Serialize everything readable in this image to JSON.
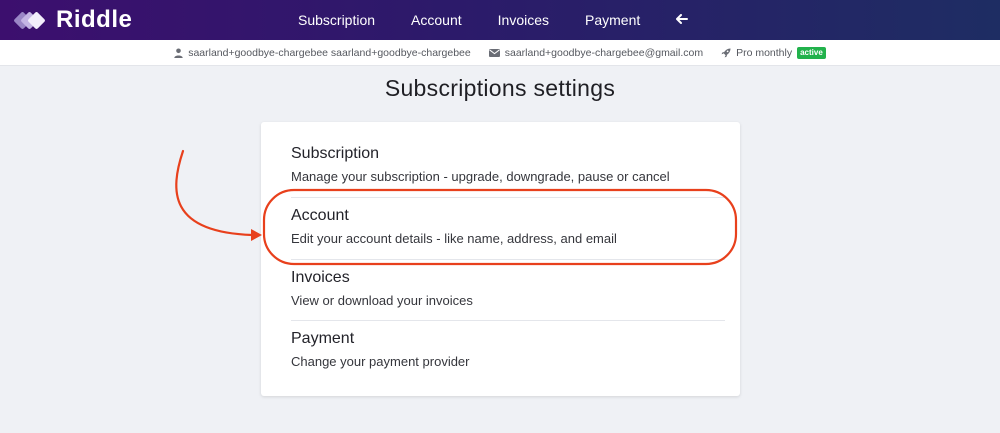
{
  "brand": {
    "name": "Riddle"
  },
  "nav": {
    "links": [
      "Subscription",
      "Account",
      "Invoices",
      "Payment"
    ],
    "back_icon": "left-arrow-icon"
  },
  "user_bar": {
    "name": "saarland+goodbye-chargebee saarland+goodbye-chargebee",
    "email": "saarland+goodbye-chargebee@gmail.com",
    "plan": "Pro monthly",
    "status": "active"
  },
  "page": {
    "title": "Subscriptions settings"
  },
  "options": [
    {
      "title": "Subscription",
      "description": "Manage your subscription - upgrade, downgrade, pause or cancel"
    },
    {
      "title": "Account",
      "description": "Edit your account details - like name, address, and email"
    },
    {
      "title": "Invoices",
      "description": "View or download your invoices"
    },
    {
      "title": "Payment",
      "description": "Change your payment provider"
    }
  ],
  "colors": {
    "nav_gradient_start": "#3c0f6e",
    "nav_gradient_end": "#1e2d63",
    "badge_green": "#22b24c",
    "annotation_red": "#e8401c"
  }
}
